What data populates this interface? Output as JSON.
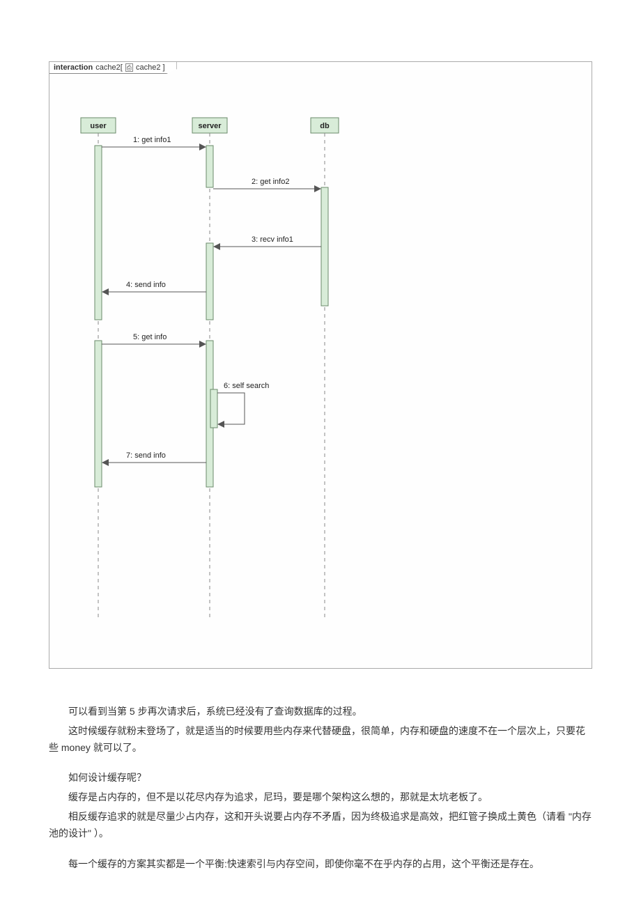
{
  "frame": {
    "keyword": "interaction",
    "name1": "cache2[",
    "icon": "⎙",
    "name2": "cache2 ]"
  },
  "lifelines": {
    "user": "user",
    "server": "server",
    "db": "db"
  },
  "messages": {
    "m1": "1: get info1",
    "m2": "2: get info2",
    "m3": "3: recv info1",
    "m4": "4: send info",
    "m5": "5: get info",
    "m6": "6: self search",
    "m7": "7: send info"
  },
  "text": {
    "p1": "可以看到当第 5 步再次请求后，系统已经没有了查询数据库的过程。",
    "p2": "这时候缓存就粉末登场了，就是适当的时候要用些内存来代替硬盘，很简单，内存和硬盘的速度不在一个层次上，只要花些 money 就可以了。",
    "p3": "如何设计缓存呢？",
    "p4": "缓存是占内存的，但不是以花尽内存为追求，尼玛，要是哪个架构这么想的，那就是太坑老板了。",
    "p5": "相反缓存追求的就是尽量少占内存，这和开头说要占内存不矛盾，因为终极追求是高效，把红管子换成土黄色（请看 \"内存池的设计\" ）。",
    "p6": "每一个缓存的方案其实都是一个平衡:快速索引与内存空间，即使你毫不在乎内存的占用，这个平衡还是存在。"
  },
  "chart_data": {
    "type": "sequence-diagram",
    "title": "interaction cache2",
    "participants": [
      "user",
      "server",
      "db"
    ],
    "messages": [
      {
        "seq": 1,
        "from": "user",
        "to": "server",
        "label": "get info1",
        "direction": "right"
      },
      {
        "seq": 2,
        "from": "server",
        "to": "db",
        "label": "get info2",
        "direction": "right"
      },
      {
        "seq": 3,
        "from": "db",
        "to": "server",
        "label": "recv info1",
        "direction": "left"
      },
      {
        "seq": 4,
        "from": "server",
        "to": "user",
        "label": "send info",
        "direction": "left"
      },
      {
        "seq": 5,
        "from": "user",
        "to": "server",
        "label": "get info",
        "direction": "right"
      },
      {
        "seq": 6,
        "from": "server",
        "to": "server",
        "label": "self search",
        "direction": "self"
      },
      {
        "seq": 7,
        "from": "server",
        "to": "user",
        "label": "send info",
        "direction": "left"
      }
    ]
  }
}
